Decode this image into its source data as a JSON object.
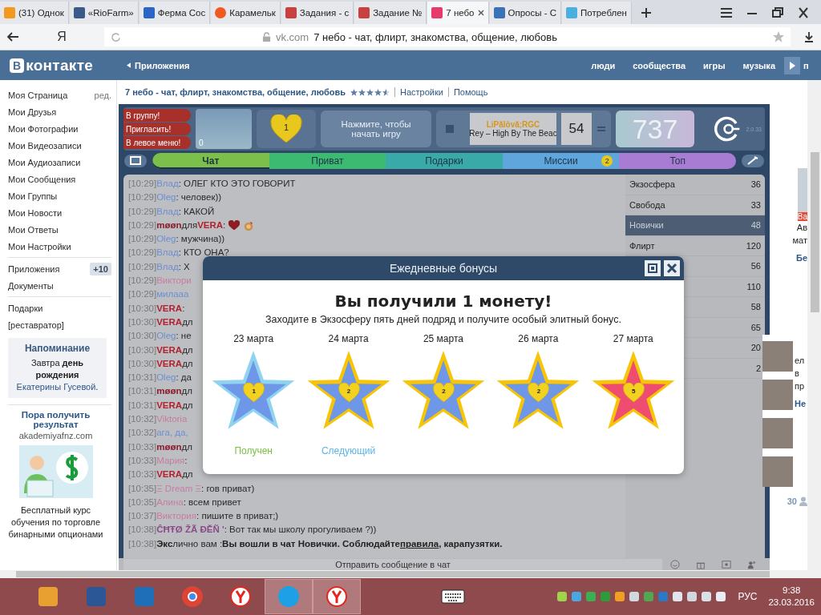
{
  "browser": {
    "tabs": [
      {
        "title": "(31) Однок",
        "kind": "orange",
        "selected": false
      },
      {
        "title": "«RioFarm»",
        "kind": "bird",
        "selected": false
      },
      {
        "title": "Ферма Сос",
        "kind": "blue",
        "selected": false
      },
      {
        "title": "Карамельк",
        "kind": "orange-round",
        "selected": false
      },
      {
        "title": "Задания - с",
        "kind": "sp",
        "selected": false
      },
      {
        "title": "Задание №",
        "kind": "sp",
        "selected": false
      },
      {
        "title": "7 небо",
        "kind": "heart",
        "selected": true
      },
      {
        "title": "Опросы - С",
        "kind": "swirl",
        "selected": false
      },
      {
        "title": "Потреблен",
        "kind": "snow",
        "selected": false
      }
    ],
    "search_logo": "Я",
    "address": {
      "domain": "vk.com",
      "title": "7 небо - чат, флирт, знакомства, общение, любовь"
    }
  },
  "vk_header": {
    "logo_mark": "В",
    "logo_text": "контакте",
    "back_link": "Приложения",
    "nav": [
      "люди",
      "сообщества",
      "игры",
      "музыка"
    ],
    "nav_cut": "п"
  },
  "sidebar": {
    "groups": [
      [
        {
          "label": "Моя Страница",
          "extra": "ред."
        },
        {
          "label": "Мои Друзья"
        },
        {
          "label": "Мои Фотографии"
        },
        {
          "label": "Мои Видеозаписи"
        },
        {
          "label": "Мои Аудиозаписи"
        },
        {
          "label": "Мои Сообщения"
        },
        {
          "label": "Мои Группы"
        },
        {
          "label": "Мои Новости"
        },
        {
          "label": "Мои Ответы"
        },
        {
          "label": "Мои Настройки"
        }
      ],
      [
        {
          "label": "Приложения",
          "badge": "+10"
        },
        {
          "label": "Документы"
        }
      ],
      [
        {
          "label": "Подарки"
        },
        {
          "label": "[реставратор]"
        }
      ]
    ],
    "reminder": {
      "title": "Напоминание",
      "text": "Завтра **день рождения**",
      "link": "Екатерины Гусевой",
      "after": "."
    },
    "ad": {
      "title": "Пора получить результат",
      "domain": "akademiyafnz.com",
      "text": "Бесплатный курс обучения по торговле бинарными опционами"
    }
  },
  "app_title": {
    "title": "7 небо - чат, флирт, знакомства, общение, любовь",
    "stars": 4.5,
    "links": [
      "Настройки",
      "Помощь"
    ]
  },
  "game": {
    "side_buttons": [
      "В группу!",
      "Пригласить!",
      "В левое меню!"
    ],
    "photo_count": "0",
    "hearts": "1",
    "play_button": "Нажмите, чтобы начать игру",
    "player": {
      "artist": "LiPălövă;RGC",
      "track": "Rey – High By The Beac",
      "number": "54"
    },
    "score": "737",
    "version": "2.0.33",
    "tabs": [
      {
        "label": "Чат",
        "color": "#7cbf4a",
        "selected": true
      },
      {
        "label": "Приват",
        "color": "#3dba72",
        "selected": false
      },
      {
        "label": "Подарки",
        "color": "#3aaaa8",
        "selected": false
      },
      {
        "label": "Миссии",
        "color": "#5ea6dc",
        "selected": false,
        "badge": "2"
      },
      {
        "label": "Топ",
        "color": "#a87cd2",
        "selected": false
      }
    ],
    "chat": [
      {
        "time": "[10:29]",
        "segments": [
          {
            "kind": "name",
            "text": "Влад",
            "color": "#6c8fd0"
          },
          {
            "kind": "plain",
            "text": ": ОЛЕГ КТО ЭТО ГОВОРИТ"
          }
        ]
      },
      {
        "time": "[10:29]",
        "segments": [
          {
            "kind": "name",
            "text": "Oleg",
            "color": "#6c8fd0"
          },
          {
            "kind": "plain",
            "text": ": человек))"
          }
        ]
      },
      {
        "time": "[10:29]",
        "segments": [
          {
            "kind": "name",
            "text": "Влад",
            "color": "#6c8fd0"
          },
          {
            "kind": "plain",
            "text": ": КАКОЙ"
          }
        ]
      },
      {
        "time": "[10:29]",
        "segments": [
          {
            "kind": "bold",
            "text": "møøn",
            "color": "#8a1b2c"
          },
          {
            "kind": "plain",
            "text": "для"
          },
          {
            "kind": "bold",
            "text": "VERA",
            "color": "#b3202e"
          },
          {
            "kind": "plain",
            "text": ":"
          },
          {
            "kind": "heart"
          },
          {
            "kind": "sticker"
          }
        ]
      },
      {
        "time": "[10:29]",
        "segments": [
          {
            "kind": "name",
            "text": "Oleg",
            "color": "#6c8fd0"
          },
          {
            "kind": "plain",
            "text": ": мужчина))"
          }
        ]
      },
      {
        "time": "[10:29]",
        "segments": [
          {
            "kind": "name",
            "text": "Влад",
            "color": "#6c8fd0"
          },
          {
            "kind": "plain",
            "text": ": КТО ОНА?"
          }
        ]
      },
      {
        "time": "[10:29]",
        "segments": [
          {
            "kind": "name",
            "text": "Влад",
            "color": "#6c8fd0"
          },
          {
            "kind": "plain",
            "text": ": Х"
          }
        ]
      },
      {
        "time": "[10:29]",
        "segments": [
          {
            "kind": "name",
            "text": "Виктори",
            "color": "#c77ca2"
          }
        ]
      },
      {
        "time": "[10:29]",
        "segments": [
          {
            "kind": "name",
            "text": "милааа",
            "color": "#6c8fd0"
          }
        ]
      },
      {
        "time": "[10:30]",
        "segments": [
          {
            "kind": "bold",
            "text": "VERA",
            "color": "#b3202e"
          },
          {
            "kind": "plain",
            "text": ":"
          }
        ]
      },
      {
        "time": "[10:30]",
        "segments": [
          {
            "kind": "bold",
            "text": "VERA",
            "color": "#b3202e"
          },
          {
            "kind": "plain",
            "text": "дл"
          }
        ]
      },
      {
        "time": "[10:30]",
        "segments": [
          {
            "kind": "name",
            "text": "Oleg",
            "color": "#6c8fd0"
          },
          {
            "kind": "plain",
            "text": ": не"
          }
        ]
      },
      {
        "time": "[10:30]",
        "segments": [
          {
            "kind": "bold",
            "text": "VERA",
            "color": "#b3202e"
          },
          {
            "kind": "plain",
            "text": "дл"
          }
        ]
      },
      {
        "time": "[10:30]",
        "segments": [
          {
            "kind": "bold",
            "text": "VERA",
            "color": "#b3202e"
          },
          {
            "kind": "plain",
            "text": "дл"
          }
        ]
      },
      {
        "time": "[10:31]",
        "segments": [
          {
            "kind": "name",
            "text": "Oleg",
            "color": "#6c8fd0"
          },
          {
            "kind": "plain",
            "text": ": да"
          }
        ]
      },
      {
        "time": "[10:31]",
        "segments": [
          {
            "kind": "bold",
            "text": "møøn",
            "color": "#8a1b2c"
          },
          {
            "kind": "plain",
            "text": "дл"
          }
        ]
      },
      {
        "time": "[10:31]",
        "segments": [
          {
            "kind": "bold",
            "text": "VERA",
            "color": "#b3202e"
          },
          {
            "kind": "plain",
            "text": "дл"
          }
        ]
      },
      {
        "time": "[10:32]",
        "segments": [
          {
            "kind": "name",
            "text": "Viktoria",
            "color": "#c77ca2"
          }
        ]
      },
      {
        "time": "[10:32]",
        "segments": [
          {
            "kind": "name",
            "text": "ага, да,",
            "color": "#6c8fd0"
          }
        ]
      },
      {
        "time": "[10:33]",
        "segments": [
          {
            "kind": "bold",
            "text": "møøn",
            "color": "#8a1b2c"
          },
          {
            "kind": "plain",
            "text": "дл"
          }
        ]
      },
      {
        "time": "[10:33]",
        "segments": [
          {
            "kind": "name",
            "text": "Мария",
            "color": "#c77ca2"
          },
          {
            "kind": "plain",
            "text": ":"
          }
        ]
      },
      {
        "time": "[10:33]",
        "segments": [
          {
            "kind": "bold",
            "text": "VERA",
            "color": "#b3202e"
          },
          {
            "kind": "plain",
            "text": "дл"
          }
        ]
      },
      {
        "time": "[10:35]",
        "segments": [
          {
            "kind": "name",
            "text": "Ξ Dream Ξ",
            "color": "#c77ca2"
          },
          {
            "kind": "plain",
            "text": ": гов приват)"
          }
        ]
      },
      {
        "time": "[10:35]",
        "segments": [
          {
            "kind": "name",
            "text": "Алина",
            "color": "#c77ca2"
          },
          {
            "kind": "plain",
            "text": ": всем привет"
          }
        ]
      },
      {
        "time": "[10:37]",
        "segments": [
          {
            "kind": "name",
            "text": "Виктория",
            "color": "#c77ca2"
          },
          {
            "kind": "plain",
            "text": ": пишите в приват;)"
          }
        ]
      },
      {
        "time": "[10:38]",
        "segments": [
          {
            "kind": "bold",
            "text": "ĈĦŦØ ŽÃ ĐĔÑ '",
            "color": "#8a4a8a"
          },
          {
            "kind": "plain",
            "text": ": Вот так мы школу прогуливаем ?))"
          }
        ]
      },
      {
        "time": "[10:38]",
        "segments": [
          {
            "kind": "bold",
            "text": "Экс",
            "color": "#222222"
          },
          {
            "kind": "plain",
            "text": "лично вам :"
          },
          {
            "kind": "bold",
            "text": "Вы вошли в чат Новички. Соблюдайте",
            "color": "#222222"
          },
          {
            "kind": "link",
            "text": "правила"
          },
          {
            "kind": "bold",
            "text": ", карапузятки.",
            "color": "#222222"
          }
        ]
      }
    ],
    "rooms": [
      {
        "name": "Экзосфера",
        "count": "36",
        "selected": false
      },
      {
        "name": "Свобода",
        "count": "33",
        "selected": false
      },
      {
        "name": "Новички",
        "count": "48",
        "selected": true
      },
      {
        "name": "Флирт",
        "count": "120",
        "selected": false
      },
      {
        "count": "56",
        "selected": false
      },
      {
        "count": "110",
        "selected": false
      },
      {
        "count": "58",
        "selected": false
      },
      {
        "count": "65",
        "selected": false
      },
      {
        "count": "20",
        "selected": false
      },
      {
        "count": "2",
        "selected": false
      }
    ],
    "input_placeholder": "Отправить сообщение в чат"
  },
  "modal": {
    "title": "Ежедневные бонусы",
    "headline": "Вы получили 1 монету!",
    "subtitle": "Заходите в Экзосферу пять дней подряд и получите особый элитный бонус.",
    "days": [
      {
        "date": "23 марта",
        "value": "1",
        "kind": "received",
        "status": "Получен"
      },
      {
        "date": "24 марта",
        "value": "2",
        "kind": "upcoming",
        "status": "Следующий"
      },
      {
        "date": "25 марта",
        "value": "2",
        "kind": "upcoming"
      },
      {
        "date": "26 марта",
        "value": "2",
        "kind": "upcoming"
      },
      {
        "date": "27 марта",
        "value": "5",
        "kind": "elite"
      }
    ]
  },
  "right_column": {
    "ad_label": "Ba",
    "fragments": [
      "Ав",
      "мат"
    ],
    "heading": "Бе",
    "friend_fragments": [
      "ел",
      "в",
      "пр"
    ],
    "friend_heading": "Не",
    "online_count": "30"
  },
  "taskbar": {
    "apps": [
      {
        "kind": "paint",
        "selected": false
      },
      {
        "kind": "word",
        "selected": false
      },
      {
        "kind": "gauge",
        "selected": false
      },
      {
        "kind": "chrome",
        "selected": false
      },
      {
        "kind": "yandex",
        "selected": false
      },
      {
        "kind": "skype",
        "selected": true
      },
      {
        "kind": "yandex",
        "selected": true
      }
    ],
    "language": "РУС",
    "time": "9:38",
    "date": "23.03.2016"
  }
}
